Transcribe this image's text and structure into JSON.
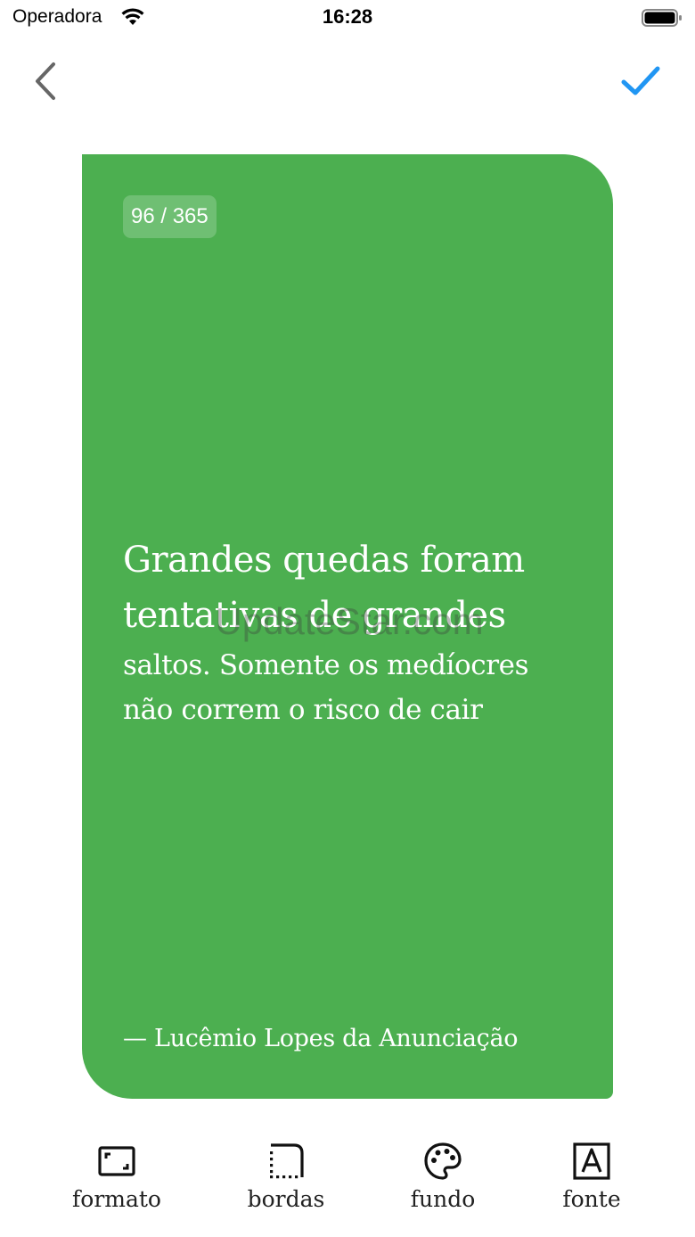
{
  "status_bar": {
    "carrier": "Operadora",
    "time": "16:28",
    "wifi_icon": "wifi-icon",
    "battery_icon": "battery-icon"
  },
  "nav": {
    "back_icon": "chevron-left-icon",
    "confirm_icon": "checkmark-icon",
    "accent_color": "#2196f3"
  },
  "card": {
    "background_color": "#4caf50",
    "counter": "96 / 365",
    "quote_lines_large": [
      "Grandes quedas foram",
      "tentativas de grandes"
    ],
    "quote_lines_small": [
      "saltos. Somente os medíocres",
      "não correm o risco de cair"
    ],
    "author": "— Lucêmio Lopes da Anunciação",
    "watermark": "UpdateStar.com"
  },
  "toolbar": {
    "items": [
      {
        "label": "formato",
        "icon": "aspect-ratio-icon"
      },
      {
        "label": "bordas",
        "icon": "border-corner-icon"
      },
      {
        "label": "fundo",
        "icon": "palette-icon"
      },
      {
        "label": "fonte",
        "icon": "font-icon"
      }
    ]
  }
}
